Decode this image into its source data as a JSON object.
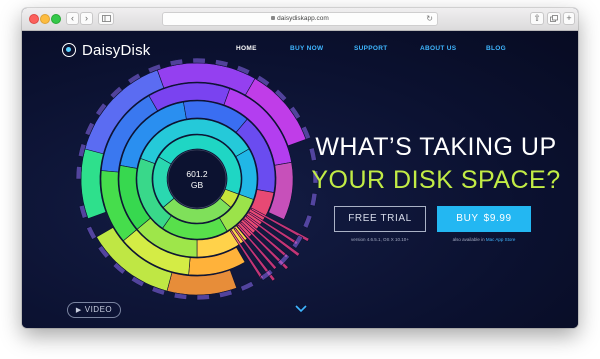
{
  "browser": {
    "url": "daisydiskapp.com",
    "back_icon": "chevron-left-icon",
    "forward_icon": "chevron-right-icon",
    "sidebar_icon": "sidebar-icon",
    "reload_icon": "reload-icon",
    "share_icon": "share-icon",
    "tabs_icon": "tabs-icon"
  },
  "header": {
    "brand": "DaisyDisk",
    "nav": [
      "HOME",
      "BUY NOW",
      "SUPPORT",
      "ABOUT US",
      "BLOG"
    ]
  },
  "hero": {
    "headline_line1": "WHAT’S TAKING UP",
    "headline_line2": "YOUR DISK SPACE?",
    "disk_size": "601.2",
    "disk_unit": "GB",
    "trial_label": "FREE TRIAL",
    "buy_label": "BUY",
    "price": "$9.99",
    "version": "version 4.6.5.1, OS X 10.10+",
    "store_prefix": "also available in ",
    "store_link": "Mac App Store",
    "video_label": "VIDEO"
  },
  "colors": {
    "accent_blue": "#23b7f2",
    "link_blue": "#3fb6ff",
    "headline_green": "#c2ec45",
    "page_bg": "#0b1130"
  }
}
